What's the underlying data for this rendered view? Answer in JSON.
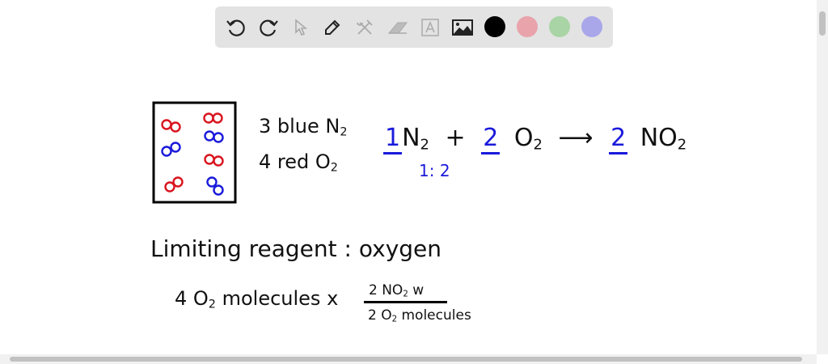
{
  "toolbar": {
    "tools": [
      "undo-icon",
      "redo-icon",
      "select-icon",
      "pen-icon",
      "tools-icon",
      "eraser-icon",
      "text-icon",
      "image-icon"
    ],
    "colors": [
      "#000000",
      "#e8a3ab",
      "#a9d4a5",
      "#a9a6ea"
    ]
  },
  "board": {
    "box_label_n2": "3 blue N",
    "box_label_o2": "4 red O",
    "sub2": "2",
    "coef1": "1",
    "n": "N",
    "plus": "+",
    "coef2": "2",
    "o": "O",
    "arrow": "⟶",
    "coef3": "2",
    "no": "NO",
    "ratio": "1: 2",
    "limiting": "Limiting reagent : oxygen",
    "calc_left_4": "4 O",
    "calc_left_rest": "molecules x",
    "numerator": "2 NO",
    "numerator_tail": "w",
    "denominator_2": "2 O",
    "denominator_rest": "molecules",
    "molecule_colors": {
      "n2": "#1a1adb",
      "o2": "#d9141e"
    }
  }
}
